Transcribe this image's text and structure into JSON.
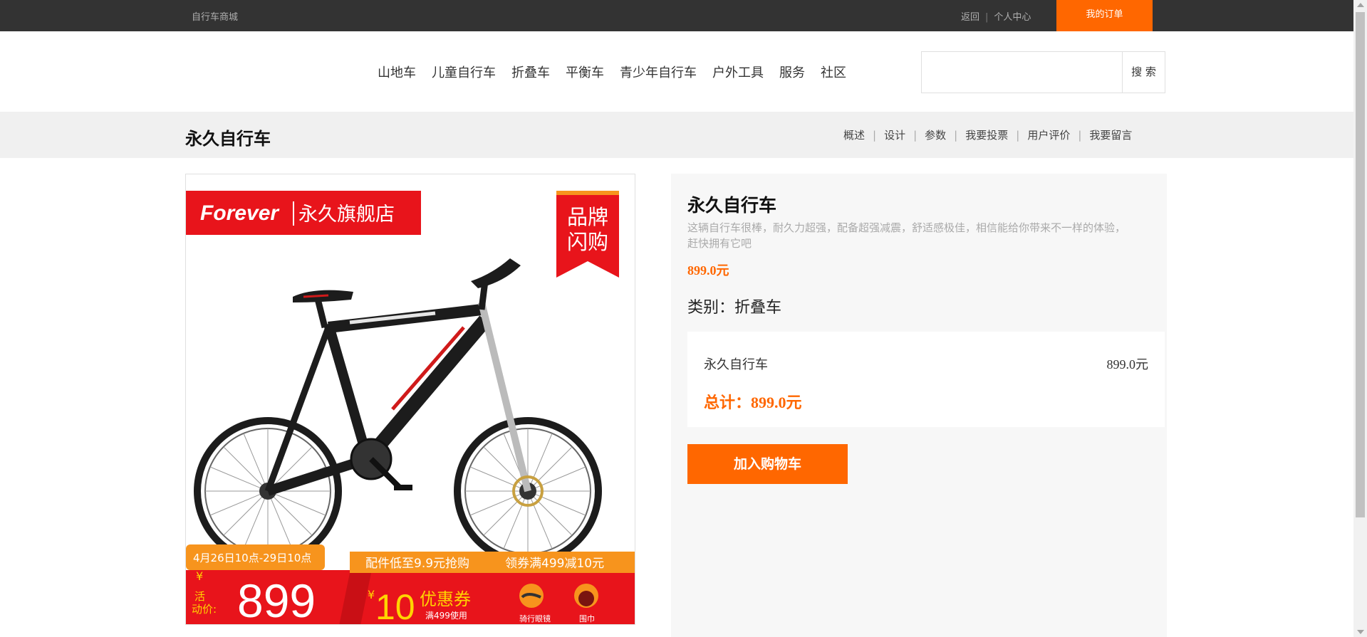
{
  "topbar": {
    "brand": "自行车商城",
    "back": "返回",
    "separator": "|",
    "profile": "个人中心",
    "orders": "我的订单"
  },
  "nav": {
    "items": [
      "山地车",
      "儿童自行车",
      "折叠车",
      "平衡车",
      "青少年自行车",
      "户外工具",
      "服务",
      "社区"
    ],
    "search_value": "",
    "search_button": "搜 索"
  },
  "product_bar": {
    "title": "永久自行车",
    "tabs": [
      "概述",
      "设计",
      "参数",
      "我要投票",
      "用户评价",
      "我要留言"
    ],
    "separator": "|"
  },
  "image": {
    "shop_logo": "Forever",
    "shop_name": "永久旗舰店",
    "flash_badge_line1": "品牌",
    "flash_badge_line2": "闪购",
    "date_range": "4月26日10点-29日10点",
    "accessory_text": "配件低至9.9元抢购",
    "coupon_text": "领券满499减10元",
    "yen": "¥",
    "promo_label_line1": "活",
    "promo_label_line2": "动价:",
    "promo_price": "899",
    "coupon_yen": "¥",
    "coupon_amount": "10",
    "coupon_label": "优惠券",
    "coupon_condition": "满499使用",
    "gift1": "骑行眼镜",
    "gift2": "围巾",
    "colors": {
      "red": "#e8141b",
      "orange": "#f7941d",
      "frame": "#1c1c1c"
    }
  },
  "info": {
    "name": "永久自行车",
    "description": "这辆自行车很棒，耐久力超强，配备超强减震，舒适感极佳，相信能给你带来不一样的体验，赶快拥有它吧",
    "price": "899.0元",
    "category": "类别：折叠车",
    "summary_name": "永久自行车",
    "summary_price": "899.0元",
    "total": "总计：899.0元",
    "add_to_cart": "加入购物车"
  },
  "colors": {
    "accent": "#ff6700",
    "topbar_bg": "#333333",
    "product_bar_bg": "#f0f0f0",
    "panel_bg": "#f7f7f7"
  }
}
